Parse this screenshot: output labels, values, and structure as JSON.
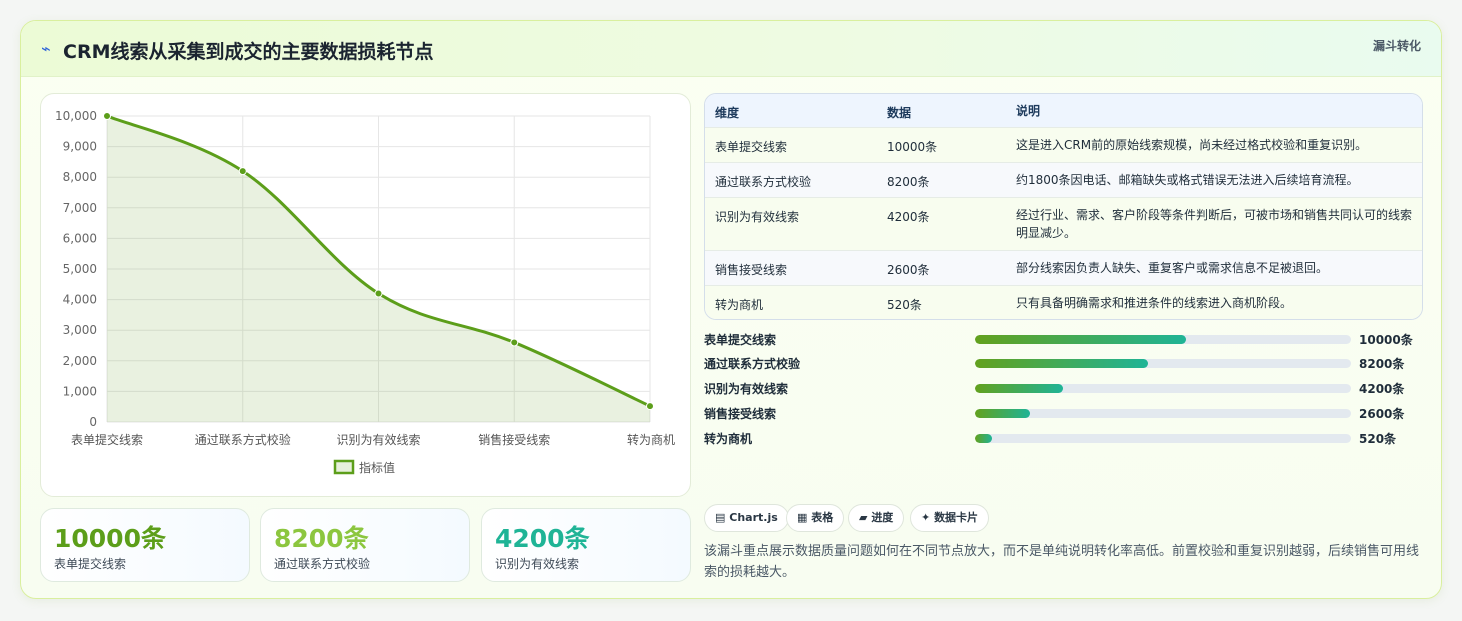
{
  "header": {
    "icon": "spark-icon",
    "title": "CRM线索从采集到成交的主要数据损耗节点",
    "tag": "漏斗转化"
  },
  "chart_data": {
    "type": "line",
    "categories": [
      "表单提交线索",
      "通过联系方式校验",
      "识别为有效线索",
      "销售接受线索",
      "转为商机"
    ],
    "series": [
      {
        "name": "指标值",
        "values": [
          10000,
          8200,
          4200,
          2600,
          520
        ]
      }
    ],
    "yticks": [
      "0",
      "1,000",
      "2,000",
      "3,000",
      "4,000",
      "5,000",
      "6,000",
      "7,000",
      "8,000",
      "9,000",
      "10,000"
    ],
    "ylim": [
      0,
      10000
    ],
    "grid": true,
    "fill": true,
    "legend": "bottom",
    "color": "#5c9e1a"
  },
  "stats": [
    {
      "value": "10000条",
      "label": "表单提交线索",
      "color": "#5c9e1a"
    },
    {
      "value": "8200条",
      "label": "通过联系方式校验",
      "color": "#8cc63f"
    },
    {
      "value": "4200条",
      "label": "识别为有效线索",
      "color": "#1fb496"
    }
  ],
  "table": {
    "headers": [
      "维度",
      "数据",
      "说明"
    ],
    "rows": [
      {
        "dim": "表单提交线索",
        "data": "10000条",
        "desc": "这是进入CRM前的原始线索规模，尚未经过格式校验和重复识别。"
      },
      {
        "dim": "通过联系方式校验",
        "data": "8200条",
        "desc": "约1800条因电话、邮箱缺失或格式错误无法进入后续培育流程。"
      },
      {
        "dim": "识别为有效线索",
        "data": "4200条",
        "desc": "经过行业、需求、客户阶段等条件判断后，可被市场和销售共同认可的线索明显减少。"
      },
      {
        "dim": "销售接受线索",
        "data": "2600条",
        "desc": "部分线索因负责人缺失、重复客户或需求信息不足被退回。"
      },
      {
        "dim": "转为商机",
        "data": "520条",
        "desc": "只有具备明确需求和推进条件的线索进入商机阶段。"
      }
    ]
  },
  "bars": [
    {
      "label": "表单提交线索",
      "value": "10000条",
      "fraction": 0.56
    },
    {
      "label": "通过联系方式校验",
      "value": "8200条",
      "fraction": 0.46
    },
    {
      "label": "识别为有效线索",
      "value": "4200条",
      "fraction": 0.235
    },
    {
      "label": "销售接受线索",
      "value": "2600条",
      "fraction": 0.145
    },
    {
      "label": "转为商机",
      "value": "520条",
      "fraction": 0.045
    }
  ],
  "chips": [
    {
      "icon": "chart-icon",
      "glyph": "▤",
      "label": "Chart.js"
    },
    {
      "icon": "table-icon",
      "glyph": "▦",
      "label": "表格"
    },
    {
      "icon": "progress-icon",
      "glyph": "▰",
      "label": "进度"
    },
    {
      "icon": "card-icon",
      "glyph": "✦",
      "label": "数据卡片"
    }
  ],
  "note": "该漏斗重点展示数据质量问题如何在不同节点放大，而不是单纯说明转化率高低。前置校验和重复识别越弱，后续销售可用线索的损耗越大。"
}
